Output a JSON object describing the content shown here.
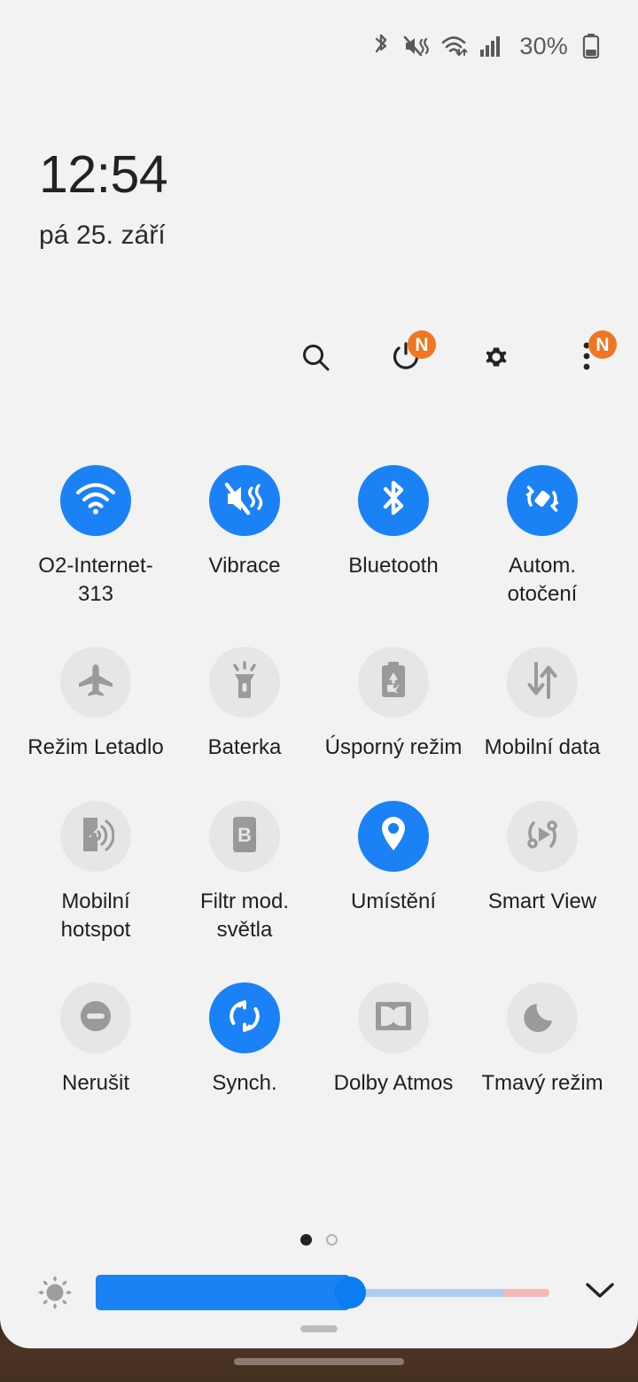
{
  "status_bar": {
    "icons": [
      "bluetooth-icon",
      "vibrate-mute-icon",
      "wifi-icon",
      "signal-icon"
    ],
    "battery_percent": "30%",
    "battery_icon": "battery-icon"
  },
  "clock": {
    "time": "12:54",
    "date": "pá 25. září"
  },
  "toolbar": {
    "search_label": "search-icon",
    "power_label": "power-icon",
    "power_badge": "N",
    "settings_label": "gear-icon",
    "more_label": "more-options-icon",
    "more_badge": "N"
  },
  "colors": {
    "accent_active": "#1a82f5",
    "tile_inactive_bg": "#e6e6e6",
    "tile_inactive_fg": "#9a9a9a",
    "badge": "#ef7622",
    "panel_bg": "#f2f2f2"
  },
  "tiles": [
    {
      "label": "O2-Internet-313",
      "icon": "wifi-icon",
      "state": "on"
    },
    {
      "label": "Vibrace",
      "icon": "vibrate-icon",
      "state": "on"
    },
    {
      "label": "Bluetooth",
      "icon": "bluetooth-icon",
      "state": "on"
    },
    {
      "label": "Autom. otočení",
      "icon": "auto-rotate-icon",
      "state": "on"
    },
    {
      "label": "Režim Letadlo",
      "icon": "airplane-icon",
      "state": "off"
    },
    {
      "label": "Baterka",
      "icon": "flashlight-icon",
      "state": "off"
    },
    {
      "label": "Úsporný režim",
      "icon": "power-saving-icon",
      "state": "off"
    },
    {
      "label": "Mobilní data",
      "icon": "mobile-data-icon",
      "state": "off"
    },
    {
      "label": "Mobilní hotspot",
      "icon": "hotspot-icon",
      "state": "off"
    },
    {
      "label": "Filtr mod. světla",
      "icon": "blue-light-filter-icon",
      "state": "off"
    },
    {
      "label": "Umístění",
      "icon": "location-pin-icon",
      "state": "on"
    },
    {
      "label": "Smart View",
      "icon": "smart-view-icon",
      "state": "off"
    },
    {
      "label": "Nerušit",
      "icon": "do-not-disturb-icon",
      "state": "off"
    },
    {
      "label": "Synch.",
      "icon": "sync-icon",
      "state": "on"
    },
    {
      "label": "Dolby Atmos",
      "icon": "dolby-icon",
      "state": "off"
    },
    {
      "label": "Tmavý režim",
      "icon": "moon-icon",
      "state": "off"
    }
  ],
  "pager": {
    "pages": 2,
    "active_page": 1
  },
  "brightness": {
    "icon": "brightness-icon",
    "value_percent": 56,
    "warn_zone_percent": 10,
    "expand_icon": "chevron-down-icon"
  },
  "panel_handle": "drag-handle",
  "nav_bar": "gesture-handle"
}
